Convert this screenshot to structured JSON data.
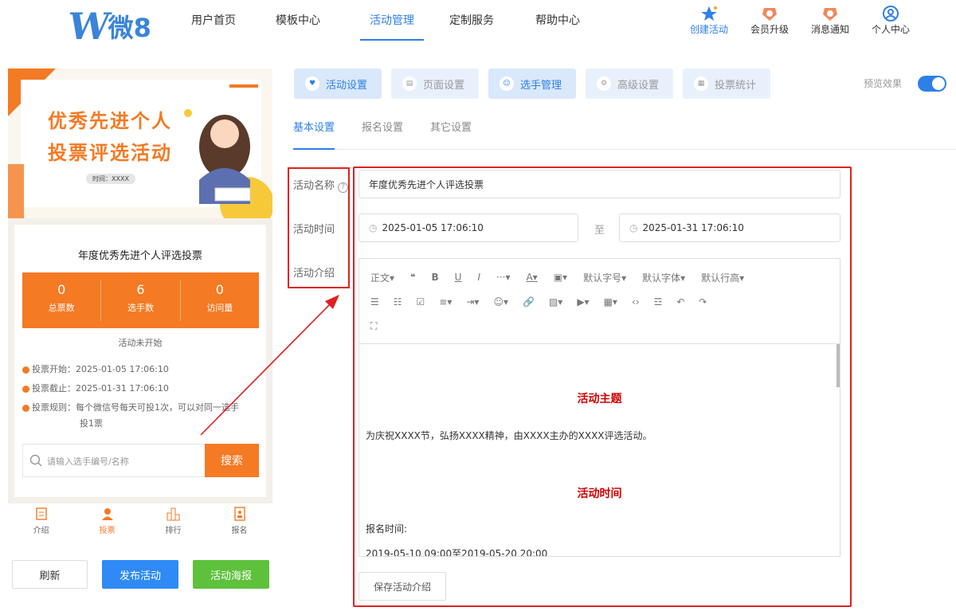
{
  "header": {
    "logo_mark": "W",
    "logo_text": "微8",
    "nav": [
      "用户首页",
      "模板中心",
      "活动管理",
      "定制服务",
      "帮助中心"
    ],
    "icons": [
      {
        "label": "创建活动",
        "icon": "star-icon"
      },
      {
        "label": "会员升级",
        "icon": "crown-icon"
      },
      {
        "label": "消息通知",
        "icon": "bell-icon"
      },
      {
        "label": "个人中心",
        "icon": "user-icon"
      }
    ]
  },
  "preview": {
    "banner_line1": "优秀先进个人",
    "banner_line2": "投票评选活动",
    "banner_time": "时间：XXXX",
    "title": "年度优秀先进个人评选投票",
    "stats": [
      {
        "n": "0",
        "l": "总票数"
      },
      {
        "n": "6",
        "l": "选手数"
      },
      {
        "n": "0",
        "l": "访问量"
      }
    ],
    "status": "活动未开始",
    "start": "投票开始：2025-01-05 17:06:10",
    "end": "投票截止：2025-01-31 17:06:10",
    "rule1": "投票规则：每个微信号每天可投1次，可以对同一选手",
    "rule2": "投1票",
    "search_placeholder": "请输入选手编号/名称",
    "search_btn": "搜索",
    "tabs": [
      "介绍",
      "投票",
      "排行",
      "报名"
    ]
  },
  "bottom_buttons": {
    "refresh": "刷新",
    "publish": "发布活动",
    "poster": "活动海报"
  },
  "top_tabs": [
    "活动设置",
    "页面设置",
    "选手管理",
    "高级设置",
    "投票统计"
  ],
  "preview_toggle": "预览效果",
  "sub_tabs": [
    "基本设置",
    "报名设置",
    "其它设置"
  ],
  "form": {
    "name_label": "活动名称",
    "name_value": "年度优秀先进个人评选投票",
    "time_label": "活动时间",
    "start": "2025-01-05 17:06:10",
    "to": "至",
    "end": "2025-01-31 17:06:10",
    "intro_label": "活动介绍",
    "save_btn": "保存活动介绍"
  },
  "toolbar": {
    "row1": [
      "正文▾",
      "❝",
      "B",
      "U",
      "I",
      "···▾",
      "A▾",
      "▣▾",
      "默认字号▾",
      "默认字体▾",
      "默认行高▾"
    ],
    "row2": [
      "☰",
      "☷",
      "☑",
      "≡▾",
      "⇥▾",
      "☺▾",
      "🔗",
      "▨▾",
      "▶▾",
      "▦▾",
      "‹›",
      "☲",
      "↶",
      "↷"
    ],
    "row3": [
      "⛶"
    ]
  },
  "editor": {
    "h1": "活动主题",
    "p1": "为庆祝XXXX节，弘扬XXXX精神，由XXXX主办的XXXX评选活动。",
    "h2": "活动时间",
    "p2": "报名时间:",
    "p3": "2019-05-10 09:00至2019-05-20 20:00"
  },
  "colors": {
    "accent": "#2f7fe8",
    "orange": "#f47a24",
    "annotation": "#e02020"
  }
}
